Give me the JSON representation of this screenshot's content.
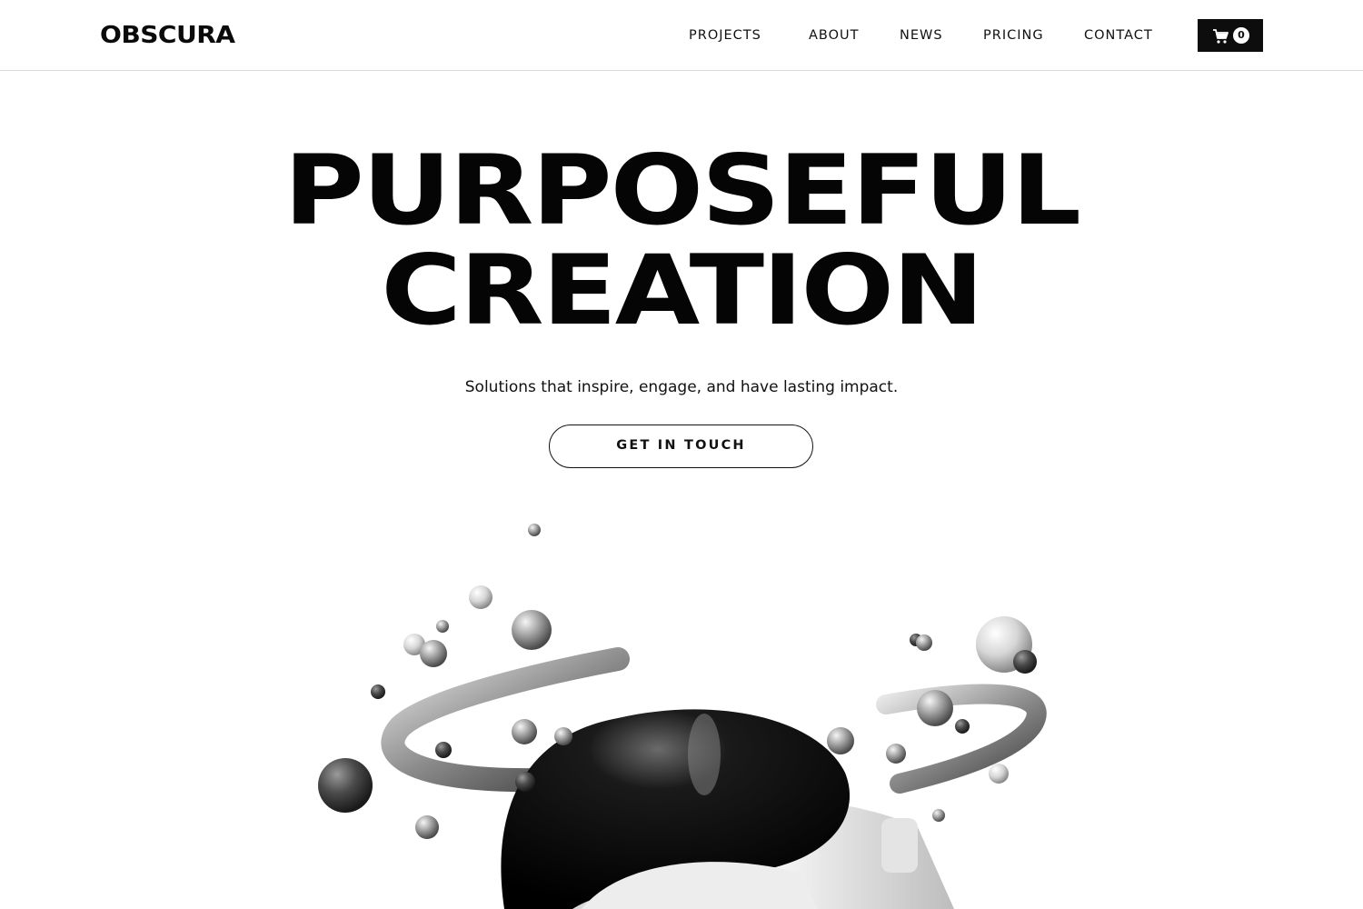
{
  "header": {
    "logo": "OBSCURA",
    "nav": [
      {
        "label": "PROJECTS"
      },
      {
        "label": "ABOUT"
      },
      {
        "label": "NEWS"
      },
      {
        "label": "PRICING"
      },
      {
        "label": "CONTACT"
      }
    ],
    "cart": {
      "icon": "cart-icon",
      "count": "0"
    }
  },
  "hero": {
    "title_line1": "PURPOSEFUL",
    "title_line2": "CREATION",
    "tagline": "Solutions that inspire, engage, and have lasting impact.",
    "cta_label": "GET IN TOUCH",
    "image": "vr-headset-with-floating-spheres-and-rings"
  },
  "colors": {
    "background": "#ffffff",
    "text": "#0a0a0a",
    "cart_bg": "#0d0d0d",
    "border": "#d9d9d9"
  }
}
